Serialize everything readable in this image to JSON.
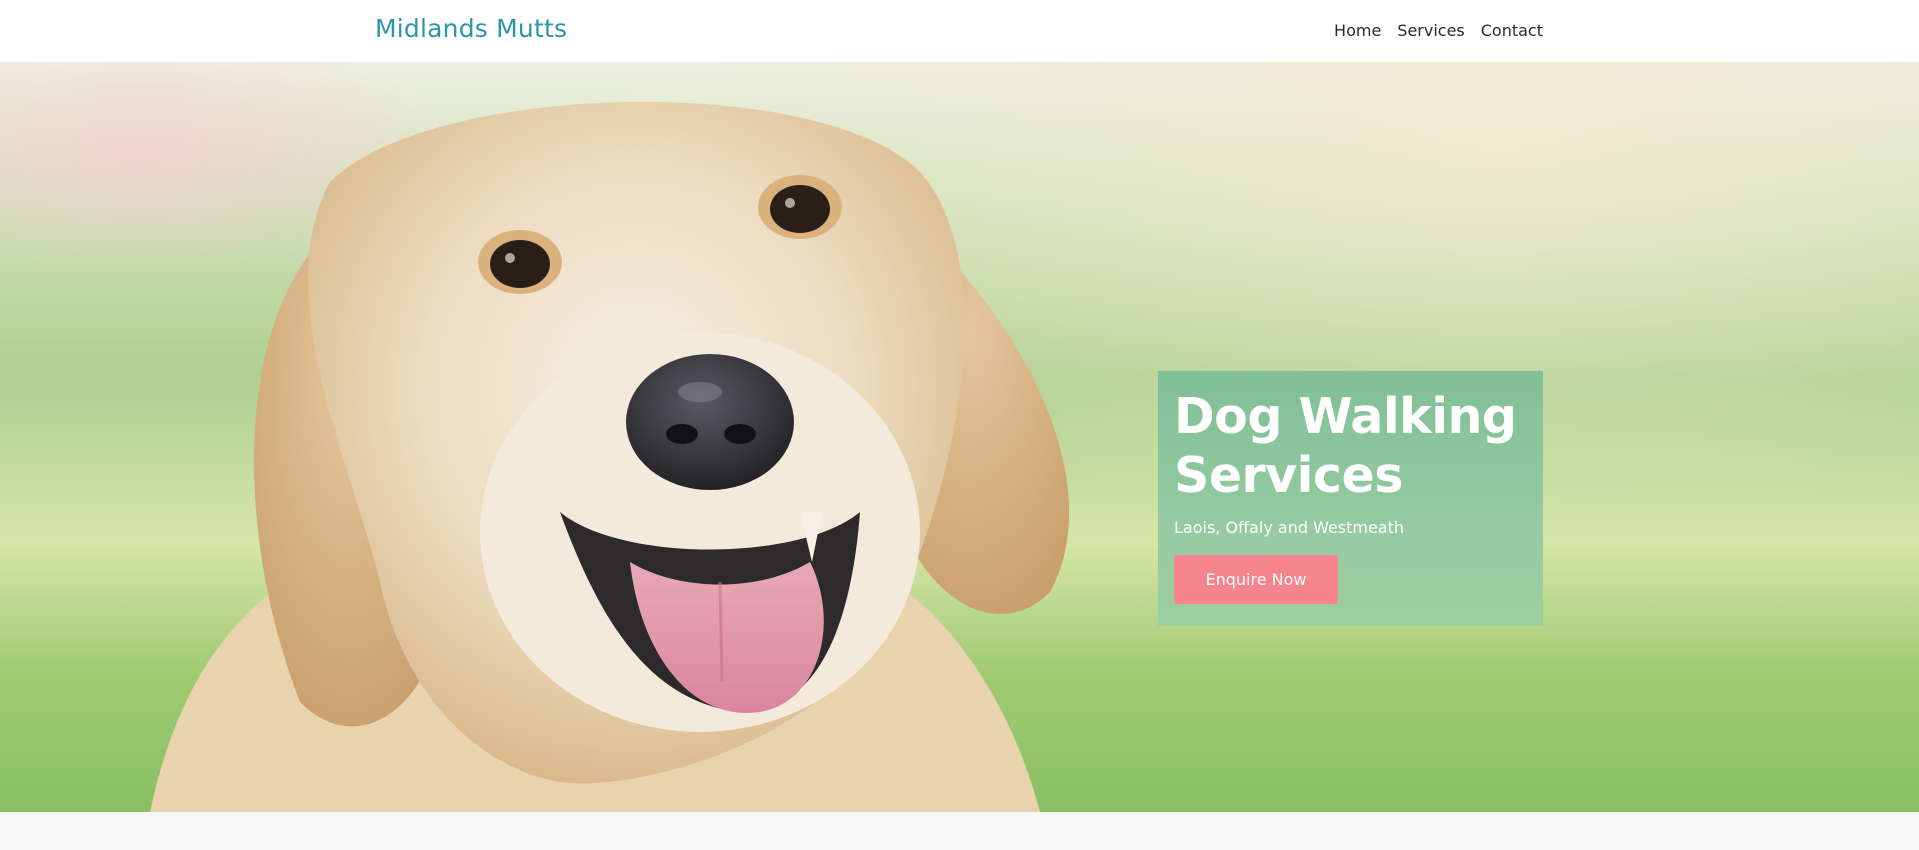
{
  "header": {
    "brand": "Midlands Mutts",
    "nav": [
      {
        "label": "Home"
      },
      {
        "label": "Services"
      },
      {
        "label": "Contact"
      }
    ]
  },
  "hero": {
    "title_line1": "Dog Walking",
    "title_line2": "Services",
    "subtitle": "Laois, Offaly and Westmeath",
    "cta_label": "Enquire Now",
    "image_subject": "golden-retriever-photo"
  },
  "colors": {
    "brand": "#2a95ab",
    "nav_text": "#2b2b2b",
    "card_overlay": "#78bc96",
    "cta": "#f6848c",
    "page_bg": "#f9f9f9"
  }
}
